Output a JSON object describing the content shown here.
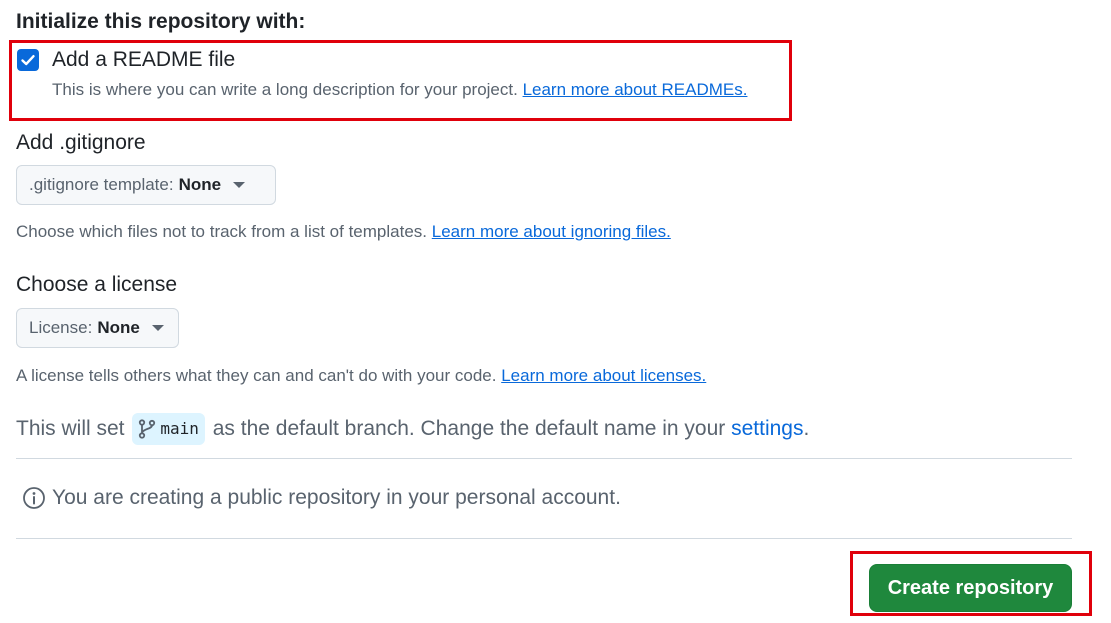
{
  "init_section": {
    "heading": "Initialize this repository with:"
  },
  "readme": {
    "label": "Add a README file",
    "checked": true,
    "description": "This is where you can write a long description for your project.",
    "link": "Learn more about READMEs."
  },
  "gitignore": {
    "heading": "Add .gitignore",
    "select_label": ".gitignore template:",
    "select_value": "None",
    "description": "Choose which files not to track from a list of templates.",
    "link": "Learn more about ignoring files."
  },
  "license": {
    "heading": "Choose a license",
    "select_label": "License:",
    "select_value": "None",
    "description": "A license tells others what they can and can't do with your code.",
    "link": "Learn more about licenses."
  },
  "default_branch": {
    "text_before": "This will set",
    "branch_name": "main",
    "text_after": "as the default branch. Change the default name in your",
    "settings_link": "settings",
    "period": "."
  },
  "notice": {
    "icon": "info-icon",
    "text": "You are creating a public repository in your personal account."
  },
  "actions": {
    "create_label": "Create repository"
  },
  "colors": {
    "accent": "#0969da",
    "primary_button": "#1f883d",
    "highlight_box": "#e0000b"
  }
}
